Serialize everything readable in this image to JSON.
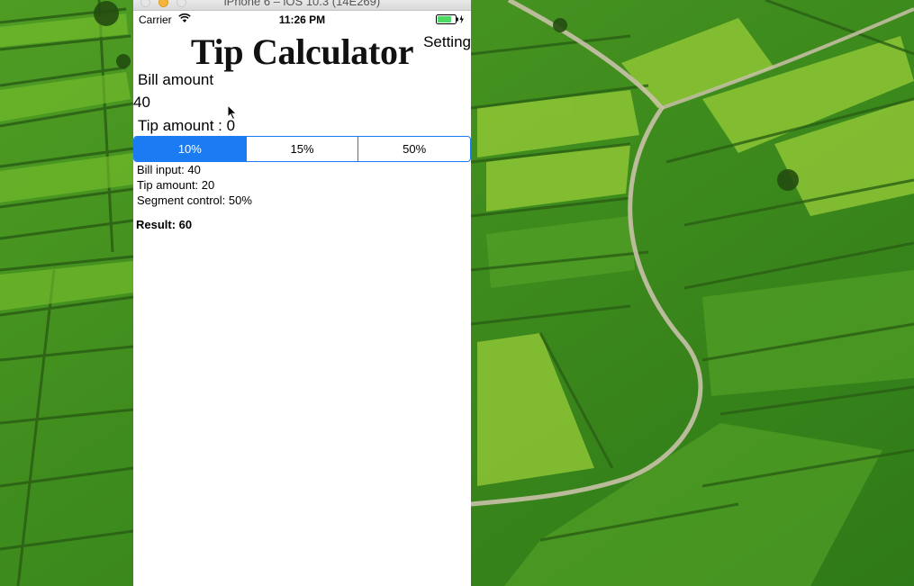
{
  "simulator": {
    "window_title": "iPhone 6 – iOS 10.3 (14E269)"
  },
  "status_bar": {
    "carrier": "Carrier",
    "time": "11:26 PM",
    "wifi_icon": "wifi-icon",
    "battery_icon": "battery-charging-icon"
  },
  "app": {
    "title": "Tip Calculator",
    "settings_label": "Setting",
    "bill_label": "Bill amount",
    "bill_value": "40",
    "tip_label": "Tip amount : 0",
    "segments": [
      {
        "label": "10%",
        "selected": true
      },
      {
        "label": "15%",
        "selected": false
      },
      {
        "label": "50%",
        "selected": false
      }
    ],
    "info": {
      "bill_input": "Bill input: 40",
      "tip_amount": "Tip amount: 20",
      "segment_control": "Segment control: 50%"
    },
    "result": "Result: 60"
  },
  "colors": {
    "accent": "#1a7bf2",
    "wallpaper_green": "#3f8a1f",
    "minimize_yellow": "#f5b53c",
    "battery_green": "#4cd964"
  }
}
